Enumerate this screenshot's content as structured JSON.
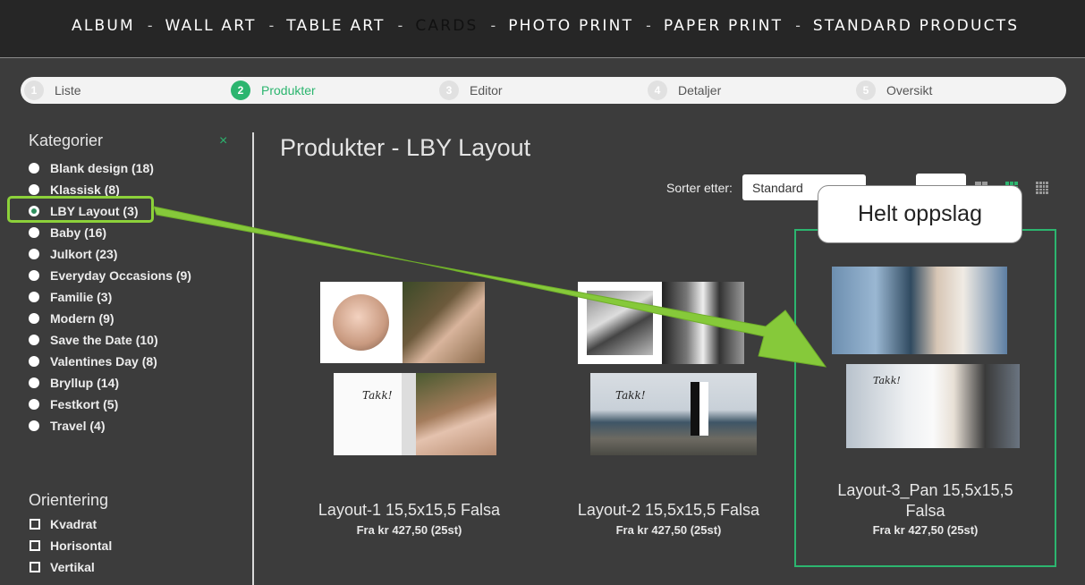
{
  "topnav": {
    "items": [
      "ALBUM",
      "WALL ART",
      "TABLE ART",
      "CARDS",
      "PHOTO PRINT",
      "PAPER PRINT",
      "STANDARD PRODUCTS"
    ],
    "separator": "-",
    "active": "CARDS"
  },
  "steps": [
    {
      "num": "1",
      "label": "Liste"
    },
    {
      "num": "2",
      "label": "Produkter",
      "active": true
    },
    {
      "num": "3",
      "label": "Editor"
    },
    {
      "num": "4",
      "label": "Detaljer"
    },
    {
      "num": "5",
      "label": "Oversikt"
    }
  ],
  "sidebar": {
    "categories_title": "Kategorier",
    "close_symbol": "×",
    "categories": [
      "Blank design (18)",
      "Klassisk (8)",
      "LBY Layout (3)",
      "Baby (16)",
      "Julkort (23)",
      "Everyday Occasions (9)",
      "Familie (3)",
      "Modern (9)",
      "Save the Date (10)",
      "Valentines Day (8)",
      "Bryllup (14)",
      "Festkort (5)",
      "Travel (4)"
    ],
    "selected_category": "LBY Layout (3)",
    "orientation_title": "Orientering",
    "orientations": [
      "Kvadrat",
      "Horisontal",
      "Vertikal"
    ]
  },
  "main": {
    "title": "Produkter - LBY Layout",
    "sort_label": "Sorter etter:",
    "sort_value": "Standard"
  },
  "products": [
    {
      "name": "Layout-1 15,5x15,5 Falsa",
      "price": "Fra kr 427,50 (25st)",
      "card_text": "Takk!"
    },
    {
      "name": "Layout-2 15,5x15,5 Falsa",
      "price": "Fra kr 427,50 (25st)",
      "card_text": "Takk!"
    },
    {
      "name_line1": "Layout-3_Pan 15,5x15,5",
      "name_line2": "Falsa",
      "price": "Fra kr 427,50 (25st)",
      "card_text": "Takk!"
    }
  ],
  "callout": "Helt oppslag",
  "colors": {
    "accent": "#2cb56f",
    "highlight": "#8cd13a"
  }
}
